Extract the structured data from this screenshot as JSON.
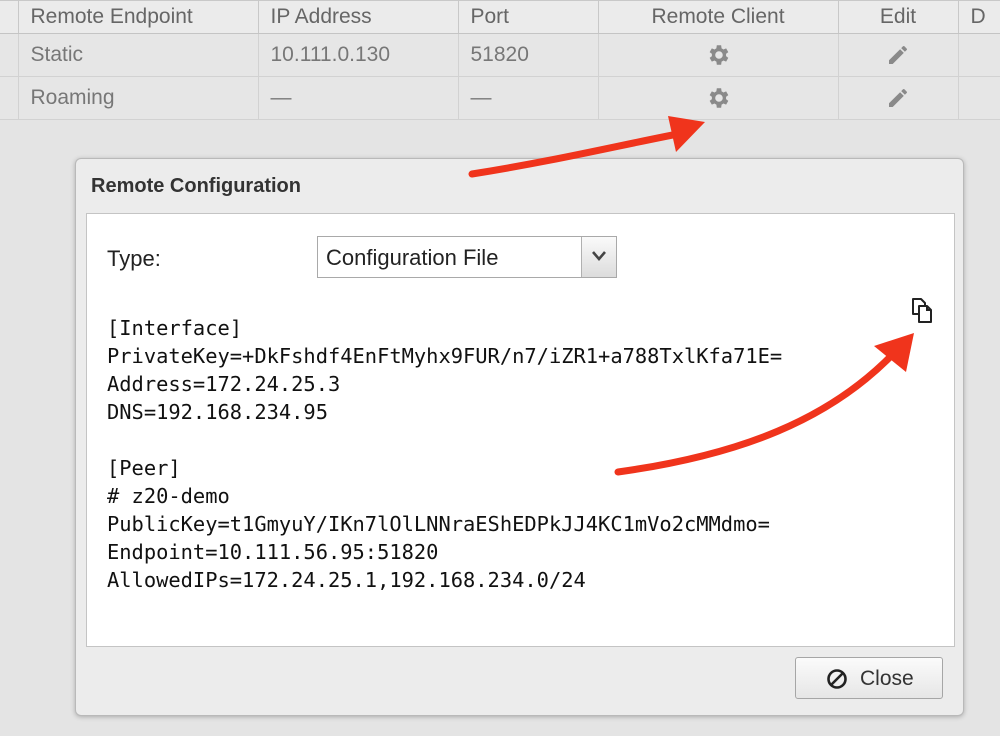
{
  "table": {
    "headers": {
      "remote_endpoint": "Remote Endpoint",
      "ip_address": "IP Address",
      "port": "Port",
      "remote_client": "Remote Client",
      "edit": "Edit",
      "next": "D"
    },
    "rows": [
      {
        "remote_endpoint": "Static",
        "ip_address": "10.111.0.130",
        "port": "51820",
        "remote_client_icon": "gear-icon",
        "edit_icon": "pencil-icon"
      },
      {
        "remote_endpoint": "Roaming",
        "ip_address": "—",
        "port": "—",
        "remote_client_icon": "gear-icon",
        "edit_icon": "pencil-icon"
      }
    ]
  },
  "dialog": {
    "title": "Remote Configuration",
    "type_label": "Type:",
    "type_selected": "Configuration File",
    "copy_icon": "copy-icon",
    "config_text": "[Interface]\nPrivateKey=+DkFshdf4EnFtMyhx9FUR/n7/iZR1+a788TxlKfa71E=\nAddress=172.24.25.3\nDNS=192.168.234.95\n\n[Peer]\n# z20-demo\nPublicKey=t1GmyuY/IKn7lOlLNNraEShEDPkJJ4KC1mVo2cMMdmo=\nEndpoint=10.111.56.95:51820\nAllowedIPs=172.24.25.1,192.168.234.0/24",
    "close_label": "Close",
    "close_icon": "cancel-circle-icon"
  },
  "colors": {
    "annotation_arrow": "#f0341c",
    "page_background": "#e4e4e4",
    "dialog_background": "#ececec"
  }
}
